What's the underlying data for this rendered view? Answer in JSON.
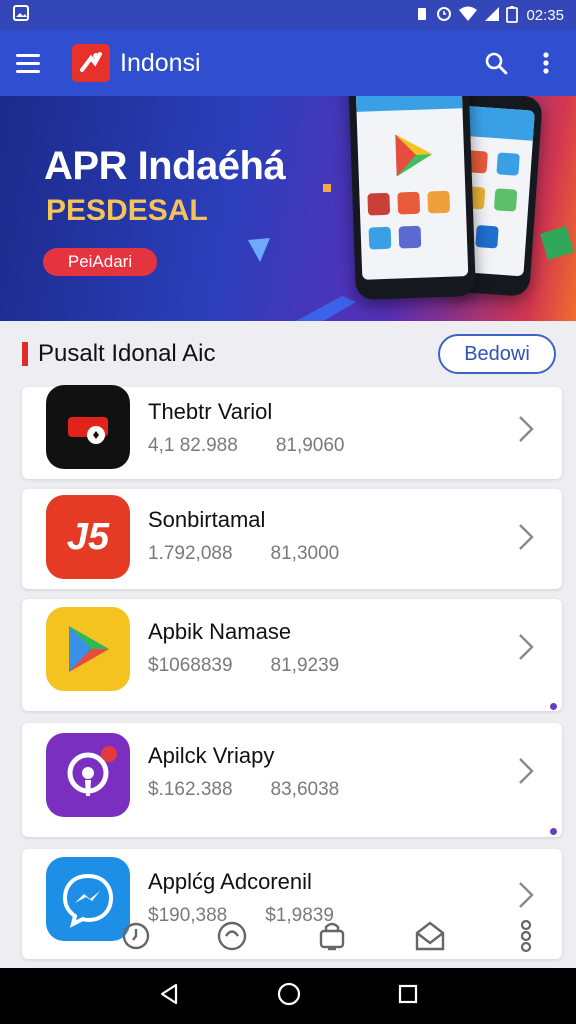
{
  "status": {
    "time": "02:35"
  },
  "appbar": {
    "title": "Indonsi",
    "logo_icon": "brand-logo-icon"
  },
  "banner": {
    "title": "APR Indaéhá",
    "subtitle": "PESDESAL",
    "cta": "PeiAdari"
  },
  "section": {
    "title": "Pusalt Idonal Aic",
    "button": "Bedowi"
  },
  "apps": [
    {
      "name": "Thebtr Variol",
      "downloads": "4,1 82.988",
      "price": "81,9060",
      "icon_label": "",
      "icon": "video-camera-icon",
      "color": "#111111"
    },
    {
      "name": "Sonbirtamal",
      "downloads": "1.792,088",
      "price": "81,3000",
      "icon_label": "J5",
      "icon": "j5-logo-icon",
      "color": "#e53a24"
    },
    {
      "name": "Apbik Namase",
      "downloads": "$1068839",
      "price": "81,9239",
      "icon_label": "",
      "icon": "play-store-icon",
      "color": "#f5c320"
    },
    {
      "name": "Apilck Vriapy",
      "downloads": "$.162.388",
      "price": "83,6038",
      "icon_label": "",
      "icon": "podcast-icon",
      "color": "#7a2fc0"
    },
    {
      "name": "Applćg Adcorenil",
      "downloads": "$190,388",
      "price": "$1,9839",
      "icon_label": "",
      "icon": "messenger-icon",
      "color": "#1e8fe6"
    }
  ],
  "accent": "#2f4fd0"
}
